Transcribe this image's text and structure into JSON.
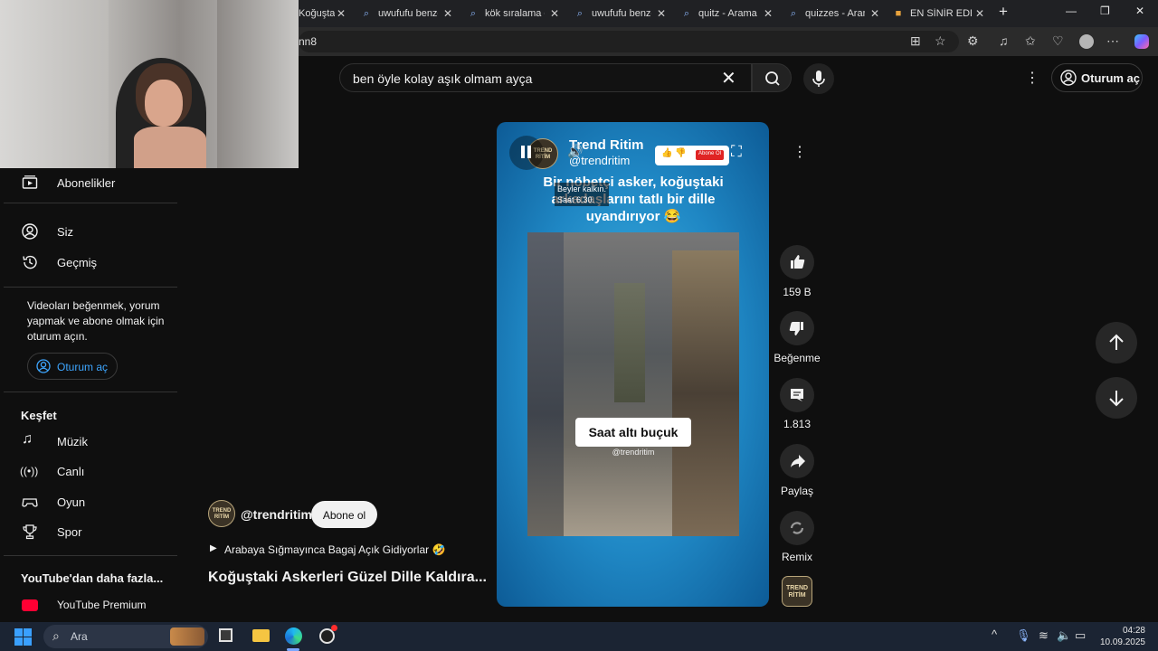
{
  "browser": {
    "tabs": [
      {
        "title": "Koğuştaki",
        "icon": "youtube-icon"
      },
      {
        "title": "uwufufu benze",
        "icon": "search-icon"
      },
      {
        "title": "kök sıralama o",
        "icon": "search-icon"
      },
      {
        "title": "uwufufu benze",
        "icon": "search-icon"
      },
      {
        "title": "quitz - Arama",
        "icon": "search-icon"
      },
      {
        "title": "quizzes - Aram",
        "icon": "search-icon"
      },
      {
        "title": "EN SİNİR EDEN",
        "icon": "app-icon"
      }
    ],
    "address": "nn8"
  },
  "youtube": {
    "search_value": "ben öyle kolay aşık olmam ayça",
    "signin_label": "Oturum aç",
    "sidebar": {
      "items_top": [
        {
          "label": "Abonelikler",
          "icon": "subscriptions-icon"
        },
        {
          "label": "Siz",
          "icon": "you-icon"
        },
        {
          "label": "Geçmiş",
          "icon": "history-icon"
        }
      ],
      "signin_message": "Videoları beğenmek, yorum yapmak ve abone olmak için oturum açın.",
      "signin_button": "Oturum aç",
      "explore_title": "Keşfet",
      "explore_items": [
        {
          "label": "Müzik",
          "icon": "music-icon"
        },
        {
          "label": "Canlı",
          "icon": "live-icon"
        },
        {
          "label": "Oyun",
          "icon": "gaming-icon"
        },
        {
          "label": "Spor",
          "icon": "trophy-icon"
        }
      ],
      "more_title": "YouTube'dan daha fazla...",
      "premium_label": "YouTube Premium"
    },
    "short": {
      "channel_name": "Trend Ritim",
      "channel_handle": "@trendritim",
      "channel_logo": "TREND RİTİM",
      "caption": "Bir nöbetçi asker, koğuştaki arkadaşlarını tatlı bir dille uyandırıyor 😂",
      "speech_line1": "Beyler kalkın.",
      "speech_line2": "Saat 6.30.",
      "subtitle": "Saat altı buçuk",
      "watermark": "@trendritim",
      "subscribe_badge": "Abone Ol",
      "owner_handle": "@trendritim",
      "subscribe_button": "Abone ol",
      "music_line": "Arabaya Sığmayınca Bagaj Açık Gidiyorlar 🤣",
      "title": "Koğuştaki Askerleri Güzel Dille Kaldıra..."
    },
    "actions": {
      "likes": "159 B",
      "dislike": "Beğenme",
      "comments": "1.813",
      "share": "Paylaş",
      "remix": "Remix"
    }
  },
  "taskbar": {
    "search_placeholder": "Ara",
    "time": "04:28",
    "date": "10.09.2025"
  }
}
